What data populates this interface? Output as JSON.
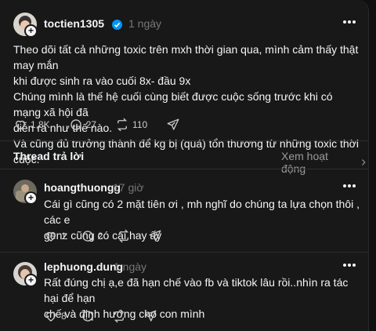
{
  "post": {
    "username": "toctien1305",
    "time": "1 ngày",
    "lines": [
      "Theo dõi tất cả những toxic trên mxh thời gian qua, mình cảm thấy thật may mắn",
      "khi được sinh ra vào cuối 8x- đầu 9x",
      "Chúng mình là thế hệ cuối cùng biết được cuộc sống trước khi có mạng xã hội đã",
      "diễn ra như thế nào.",
      "Và cũng đủ trưởng thành để kg bị (quá) tổn thương từ những toxic thời cuộc."
    ],
    "likes": "1,8K",
    "comments": "27",
    "reposts": "110"
  },
  "thread": {
    "title": "Thread trả lời",
    "activity": "Xem hoạt động"
  },
  "replies": [
    {
      "username": "hoangthuongg",
      "time": "17 giờ",
      "lines": [
        "Cái gì cũng có 2 mặt tiên ơi , mh nghĩ do chúng ta lựa chọn thôi , các e",
        "genz cũng có cái hay ấy"
      ],
      "likes": "1",
      "comments": "2"
    },
    {
      "username": "lephuong.dung",
      "time": "1 ngày",
      "lines": [
        "Rất đúng chị ạ,e đã hạn chế vào fb và tiktok lâu rồi..nhìn ra tác hại để hạn",
        "chế và định hướng cho con mình"
      ],
      "likes": "8"
    }
  ],
  "icons": {
    "like": "heart-icon",
    "comment": "comment-icon",
    "repost": "repost-icon",
    "share": "send-icon",
    "follow": "plus-icon",
    "verified": "verified-badge-icon",
    "chevron": "chevron-right-icon"
  },
  "colors": {
    "background": "#181818",
    "text": "#f3f5f7",
    "muted": "#777777",
    "verified": "#0095f6"
  }
}
